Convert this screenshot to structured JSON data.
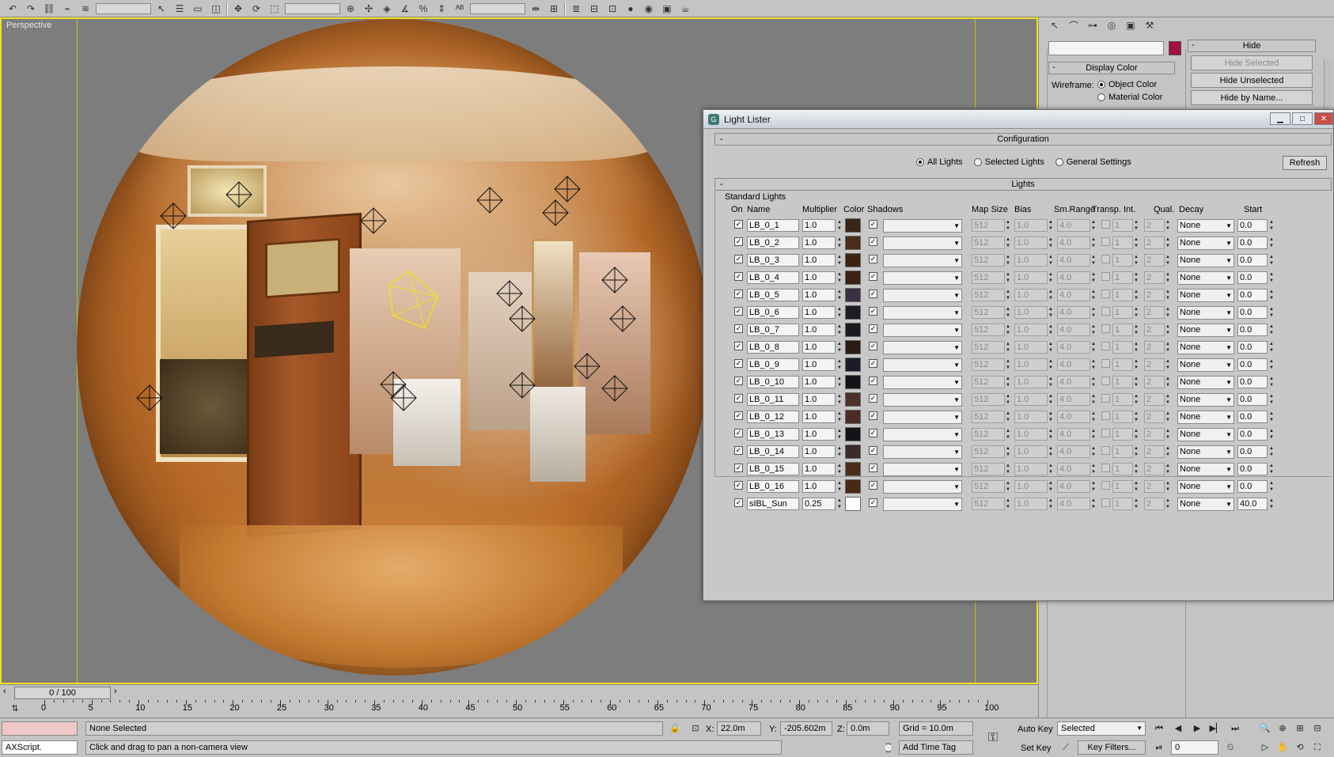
{
  "viewport": {
    "label": "Perspective"
  },
  "command_panel": {
    "hide_rollout_title": "Hide",
    "hide_selected": "Hide Selected",
    "hide_unselected": "Hide Unselected",
    "hide_by_name": "Hide by Name...",
    "display_color_title": "Display Color",
    "wireframe_label": "Wireframe:",
    "object_color": "Object Color",
    "material_color": "Material Color",
    "object_color_swatch": "#a01040"
  },
  "light_lister": {
    "title": "Light Lister",
    "configuration_title": "Configuration",
    "all_lights": "All Lights",
    "selected_lights": "Selected Lights",
    "general_settings": "General Settings",
    "refresh": "Refresh",
    "lights_title": "Lights",
    "standard_lights": "Standard Lights",
    "headers": {
      "on": "On",
      "name": "Name",
      "multiplier": "Multiplier",
      "color": "Color",
      "shadows": "Shadows",
      "map_size": "Map Size",
      "bias": "Bias",
      "sm_range": "Sm.Range",
      "transp": "Transp.",
      "int": "Int.",
      "qual": "Qual.",
      "decay": "Decay",
      "start": "Start"
    },
    "lights": [
      {
        "name": "LB_0_1",
        "multiplier": "1.0",
        "color": "#3a2418",
        "map_size": "512",
        "bias": "1.0",
        "sm_range": "4.0",
        "int": "1",
        "qual": "2",
        "decay": "None",
        "start": "0.0"
      },
      {
        "name": "LB_0_2",
        "multiplier": "1.0",
        "color": "#4a2c1c",
        "map_size": "512",
        "bias": "1.0",
        "sm_range": "4.0",
        "int": "1",
        "qual": "2",
        "decay": "None",
        "start": "0.0"
      },
      {
        "name": "LB_0_3",
        "multiplier": "1.0",
        "color": "#3c2412",
        "map_size": "512",
        "bias": "1.0",
        "sm_range": "4.0",
        "int": "1",
        "qual": "2",
        "decay": "None",
        "start": "0.0"
      },
      {
        "name": "LB_0_4",
        "multiplier": "1.0",
        "color": "#3a2214",
        "map_size": "512",
        "bias": "1.0",
        "sm_range": "4.0",
        "int": "1",
        "qual": "2",
        "decay": "None",
        "start": "0.0"
      },
      {
        "name": "LB_0_5",
        "multiplier": "1.0",
        "color": "#3a3044",
        "map_size": "512",
        "bias": "1.0",
        "sm_range": "4.0",
        "int": "1",
        "qual": "2",
        "decay": "None",
        "start": "0.0"
      },
      {
        "name": "LB_0_6",
        "multiplier": "1.0",
        "color": "#1e1c24",
        "map_size": "512",
        "bias": "1.0",
        "sm_range": "4.0",
        "int": "1",
        "qual": "2",
        "decay": "None",
        "start": "0.0"
      },
      {
        "name": "LB_0_7",
        "multiplier": "1.0",
        "color": "#1c1a1e",
        "map_size": "512",
        "bias": "1.0",
        "sm_range": "4.0",
        "int": "1",
        "qual": "2",
        "decay": "None",
        "start": "0.0"
      },
      {
        "name": "LB_0_8",
        "multiplier": "1.0",
        "color": "#2a1c14",
        "map_size": "512",
        "bias": "1.0",
        "sm_range": "4.0",
        "int": "1",
        "qual": "2",
        "decay": "None",
        "start": "0.0"
      },
      {
        "name": "LB_0_9",
        "multiplier": "1.0",
        "color": "#1c1c28",
        "map_size": "512",
        "bias": "1.0",
        "sm_range": "4.0",
        "int": "1",
        "qual": "2",
        "decay": "None",
        "start": "0.0"
      },
      {
        "name": "LB_0_10",
        "multiplier": "1.0",
        "color": "#141418",
        "map_size": "512",
        "bias": "1.0",
        "sm_range": "4.0",
        "int": "1",
        "qual": "2",
        "decay": "None",
        "start": "0.0"
      },
      {
        "name": "LB_0_11",
        "multiplier": "1.0",
        "color": "#4c3228",
        "map_size": "512",
        "bias": "1.0",
        "sm_range": "4.0",
        "int": "1",
        "qual": "2",
        "decay": "None",
        "start": "0.0"
      },
      {
        "name": "LB_0_12",
        "multiplier": "1.0",
        "color": "#4a2c24",
        "map_size": "512",
        "bias": "1.0",
        "sm_range": "4.0",
        "int": "1",
        "qual": "2",
        "decay": "None",
        "start": "0.0"
      },
      {
        "name": "LB_0_13",
        "multiplier": "1.0",
        "color": "#141418",
        "map_size": "512",
        "bias": "1.0",
        "sm_range": "4.0",
        "int": "1",
        "qual": "2",
        "decay": "None",
        "start": "0.0"
      },
      {
        "name": "LB_0_14",
        "multiplier": "1.0",
        "color": "#3a2a2a",
        "map_size": "512",
        "bias": "1.0",
        "sm_range": "4.0",
        "int": "1",
        "qual": "2",
        "decay": "None",
        "start": "0.0"
      },
      {
        "name": "LB_0_15",
        "multiplier": "1.0",
        "color": "#4a2c18",
        "map_size": "512",
        "bias": "1.0",
        "sm_range": "4.0",
        "int": "1",
        "qual": "2",
        "decay": "None",
        "start": "0.0"
      },
      {
        "name": "LB_0_16",
        "multiplier": "1.0",
        "color": "#4a2816",
        "map_size": "512",
        "bias": "1.0",
        "sm_range": "4.0",
        "int": "1",
        "qual": "2",
        "decay": "None",
        "start": "0.0"
      },
      {
        "name": "sIBL_Sun",
        "multiplier": "0.25",
        "color": "#ffffff",
        "map_size": "512",
        "bias": "1.0",
        "sm_range": "4.0",
        "int": "1",
        "qual": "2",
        "decay": "None",
        "start": "40.0"
      }
    ]
  },
  "timeline": {
    "frame_display": "0 / 100",
    "ticks": [
      "0",
      "5",
      "10",
      "15",
      "20",
      "25",
      "30",
      "35",
      "40",
      "45",
      "50",
      "55",
      "60",
      "65",
      "70",
      "75",
      "80",
      "85",
      "90",
      "95",
      "100"
    ]
  },
  "status": {
    "maxscript": "AXScript.",
    "selection": "None Selected",
    "prompt": "Click and drag to pan a non-camera view",
    "x_label": "X:",
    "x_value": "22.0m",
    "y_label": "Y:",
    "y_value": "-205.602m",
    "z_label": "Z:",
    "z_value": "0.0m",
    "grid": "Grid = 10.0m",
    "add_time_tag": "Add Time Tag",
    "auto_key": "Auto Key",
    "set_key": "Set Key",
    "key_mode": "Selected",
    "key_filters": "Key Filters...",
    "frame_field": "0"
  }
}
